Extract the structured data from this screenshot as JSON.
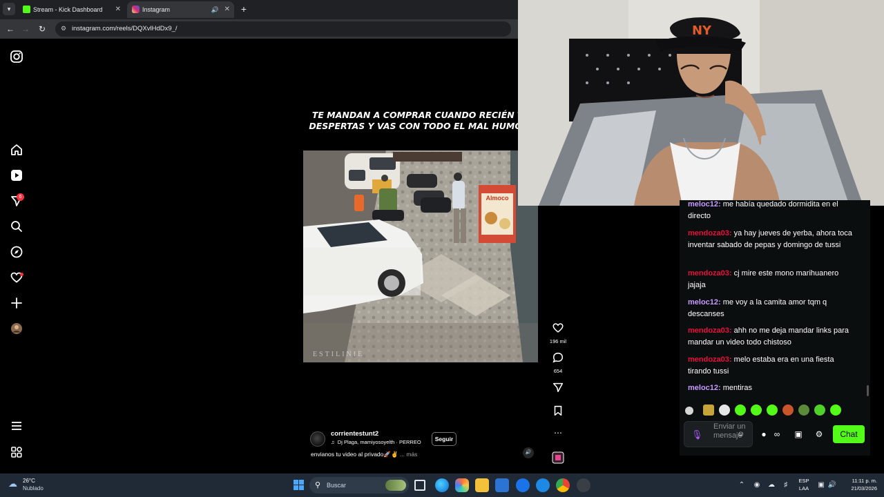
{
  "browser": {
    "tabs": [
      {
        "title": "Stream - Kick Dashboard"
      },
      {
        "title": "Instagram"
      }
    ],
    "url": "instagram.com/reels/DQXvlHdDx9_/"
  },
  "ig_nav": {
    "notifications_badge": "6"
  },
  "reel": {
    "caption_overlay": "TE MANDAN A COMPRAR CUANDO RECIÉN TE DESPERTAS Y VAS CON TODO EL MAL HUMOR:",
    "watermark": "ESTILINIE",
    "sign_text": "Almoco",
    "username": "corrientestunt2",
    "music": "Dj Plaga, mamiyosoyelth · PERREO",
    "follow_label": "Seguir",
    "description": "envianos tu video al privado🚀✌️",
    "more_label": "... más",
    "likes": "196 mil",
    "comments": "654"
  },
  "chat": {
    "messages": [
      {
        "user": "meloc12",
        "color": "purple",
        "text": "me había quedado dormidita en el directo"
      },
      {
        "user": "mendoza03",
        "color": "red",
        "text": "ya hay jueves de yerba, ahora toca inventar sabado de pepas y domingo de tussi"
      },
      {
        "user": "mendoza03",
        "color": "red",
        "text": "cj mire este mono marihuanero jajaja"
      },
      {
        "user": "meloc12",
        "color": "purple",
        "text": "me voy a la camita amor tqm q descanses"
      },
      {
        "user": "mendoza03",
        "color": "red",
        "text": "ahh no me deja mandar links para mandar un video todo chistoso"
      },
      {
        "user": "mendoza03",
        "color": "red",
        "text": "melo estaba era en una fiesta tirando tussi"
      },
      {
        "user": "meloc12",
        "color": "purple",
        "text": "mentiras"
      }
    ],
    "input_placeholder": "Enviar un mensaje",
    "send_label": "Chat",
    "accent": "#53fc18"
  },
  "taskbar": {
    "weather_temp": "26°C",
    "weather_desc": "Nublado",
    "search_placeholder": "Buscar",
    "lang_1": "ESP",
    "lang_2": "LAA",
    "time": "11:11 p. m.",
    "date": "21/03/2026"
  }
}
